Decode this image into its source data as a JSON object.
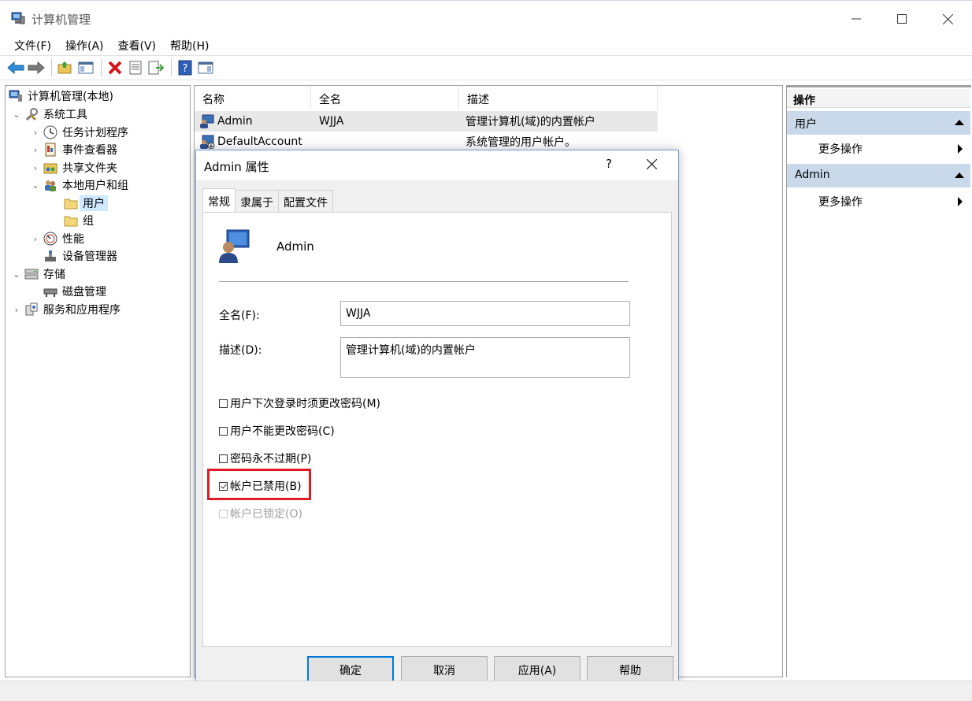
{
  "window": {
    "title": "计算机管理"
  },
  "menu": [
    "文件(F)",
    "操作(A)",
    "查看(V)",
    "帮助(H)"
  ],
  "tree": {
    "root": "计算机管理(本地)",
    "system_tools": "系统工具",
    "task_scheduler": "任务计划程序",
    "event_viewer": "事件查看器",
    "shared_folders": "共享文件夹",
    "local_users_groups": "本地用户和组",
    "users": "用户",
    "groups": "组",
    "performance": "性能",
    "device_manager": "设备管理器",
    "storage": "存储",
    "disk_management": "磁盘管理",
    "services_apps": "服务和应用程序"
  },
  "list": {
    "headers": [
      "名称",
      "全名",
      "描述"
    ],
    "rows": [
      {
        "name": "Admin",
        "fullname": "WJJA",
        "desc": "管理计算机(域)的内置帐户"
      },
      {
        "name": "DefaultAccount",
        "fullname": "",
        "desc": "系统管理的用户帐户。"
      }
    ]
  },
  "actions": {
    "header": "操作",
    "section1": "用户",
    "more1": "更多操作",
    "section2": "Admin",
    "more2": "更多操作"
  },
  "dialog": {
    "title": "Admin 属性",
    "help": "?",
    "tabs": [
      "常规",
      "隶属于",
      "配置文件"
    ],
    "username": "Admin",
    "fullname_label": "全名(F):",
    "fullname_value": "WJJA",
    "desc_label": "描述(D):",
    "desc_value": "管理计算机(域)的内置帐户",
    "checkboxes": [
      {
        "label": "用户下次登录时须更改密码(M)",
        "checked": false,
        "disabled": false
      },
      {
        "label": "用户不能更改密码(C)",
        "checked": false,
        "disabled": false
      },
      {
        "label": "密码永不过期(P)",
        "checked": false,
        "disabled": false
      },
      {
        "label": "帐户已禁用(B)",
        "checked": true,
        "disabled": false
      },
      {
        "label": "帐户已锁定(O)",
        "checked": false,
        "disabled": true
      }
    ],
    "buttons": {
      "ok": "确定",
      "cancel": "取消",
      "apply": "应用(A)",
      "help": "帮助"
    }
  },
  "colors": {
    "highlight": "#e01b24",
    "accent": "#0078d7",
    "section_bg": "#c9d9ea"
  }
}
